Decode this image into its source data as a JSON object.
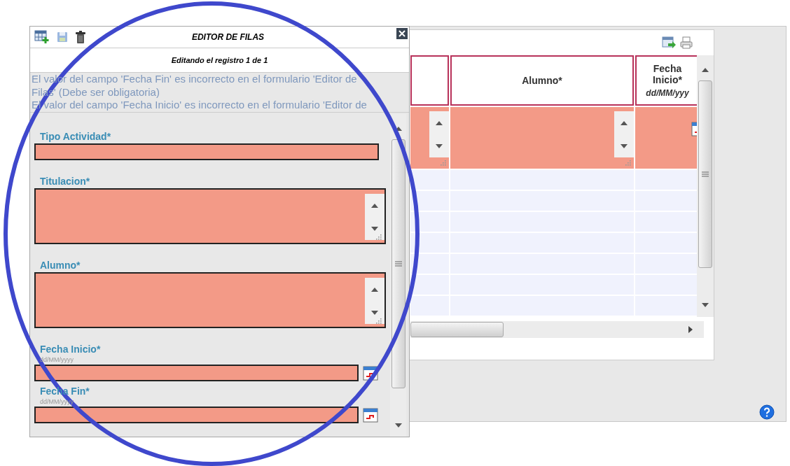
{
  "grid": {
    "columns": [
      {
        "kind": "textarea"
      },
      {
        "label": "Alumno*",
        "kind": "textarea"
      },
      {
        "label": "Fecha Inicio*",
        "format": "dd/MM/yyy",
        "kind": "date"
      }
    ],
    "rows": [
      {
        "invalid": true
      }
    ]
  },
  "dialog": {
    "title": "EDITOR DE FILAS",
    "subtitle": "Editando el registro 1 de 1",
    "errors": [
      "El valor del campo 'Fecha Fin' es incorrecto en el formulario 'Editor de Filas' (Debe ser obligatoria)",
      "El valor del campo 'Fecha Inicio' es incorrecto en el formulario 'Editor de"
    ],
    "fields": [
      {
        "label": "Tipo Actividad*",
        "kind": "text",
        "invalid": true
      },
      {
        "label": "Titulacion*",
        "kind": "textarea",
        "invalid": true
      },
      {
        "label": "Alumno*",
        "kind": "textarea",
        "invalid": true
      },
      {
        "label": "Fecha Inicio*",
        "hint": "dd/MM/yyyy",
        "kind": "date",
        "invalid": true
      },
      {
        "label": "Fecha Fin*",
        "hint": "dd/MM/yyyy",
        "kind": "date",
        "invalid": true
      }
    ]
  }
}
